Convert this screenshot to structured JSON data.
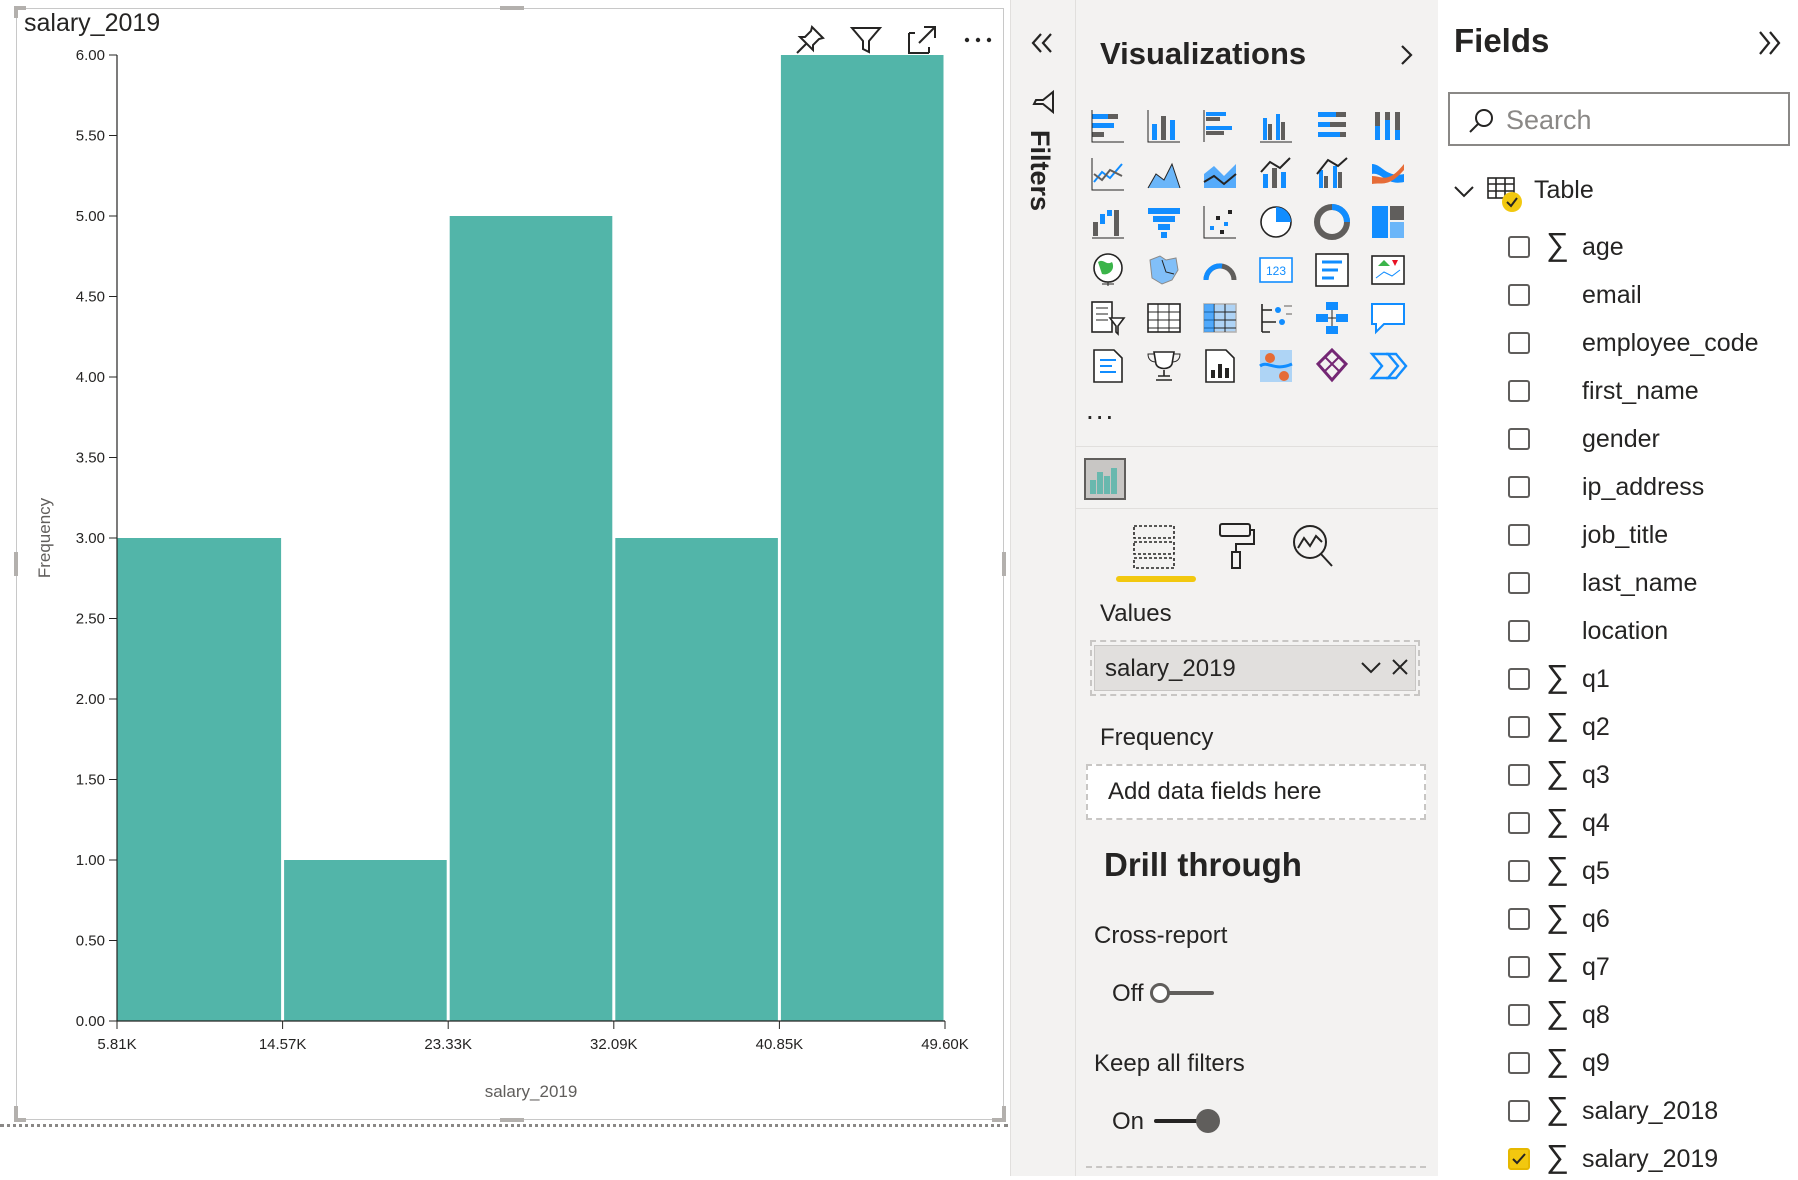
{
  "visual": {
    "title": "salary_2019",
    "header_icons": [
      "pin-icon",
      "filter-icon",
      "focus-mode-icon",
      "more-options-icon"
    ]
  },
  "chart_data": {
    "type": "bar",
    "title": "salary_2019",
    "xlabel": "salary_2019",
    "ylabel": "Frequency",
    "bin_edges": [
      "5.81K",
      "14.57K",
      "23.33K",
      "32.09K",
      "40.85K",
      "49.60K"
    ],
    "values": [
      3,
      1,
      5,
      3,
      6
    ],
    "yticks": [
      "0.00",
      "0.50",
      "1.00",
      "1.50",
      "2.00",
      "2.50",
      "3.00",
      "3.50",
      "4.00",
      "4.50",
      "5.00",
      "5.50",
      "6.00"
    ],
    "ylim": [
      0,
      6
    ],
    "bar_color": "#52b5a9",
    "grid": false
  },
  "filters": {
    "label": "Filters"
  },
  "visualizations": {
    "title": "Visualizations",
    "more_label": "...",
    "values_label": "Values",
    "values_field": "salary_2019",
    "frequency_label": "Frequency",
    "frequency_placeholder": "Add data fields here",
    "drill_through_title": "Drill through",
    "cross_report_label": "Cross-report",
    "cross_report_state": "Off",
    "keep_filters_label": "Keep all filters",
    "keep_filters_state": "On",
    "accent_color": "#f2c80f"
  },
  "fields": {
    "title": "Fields",
    "search_placeholder": "Search",
    "table_name": "Table",
    "items": [
      {
        "name": "age",
        "numeric": true,
        "checked": false
      },
      {
        "name": "email",
        "numeric": false,
        "checked": false
      },
      {
        "name": "employee_code",
        "numeric": false,
        "checked": false
      },
      {
        "name": "first_name",
        "numeric": false,
        "checked": false
      },
      {
        "name": "gender",
        "numeric": false,
        "checked": false
      },
      {
        "name": "ip_address",
        "numeric": false,
        "checked": false
      },
      {
        "name": "job_title",
        "numeric": false,
        "checked": false
      },
      {
        "name": "last_name",
        "numeric": false,
        "checked": false
      },
      {
        "name": "location",
        "numeric": false,
        "checked": false
      },
      {
        "name": "q1",
        "numeric": true,
        "checked": false
      },
      {
        "name": "q2",
        "numeric": true,
        "checked": false
      },
      {
        "name": "q3",
        "numeric": true,
        "checked": false
      },
      {
        "name": "q4",
        "numeric": true,
        "checked": false
      },
      {
        "name": "q5",
        "numeric": true,
        "checked": false
      },
      {
        "name": "q6",
        "numeric": true,
        "checked": false
      },
      {
        "name": "q7",
        "numeric": true,
        "checked": false
      },
      {
        "name": "q8",
        "numeric": true,
        "checked": false
      },
      {
        "name": "q9",
        "numeric": true,
        "checked": false
      },
      {
        "name": "salary_2018",
        "numeric": true,
        "checked": false
      },
      {
        "name": "salary_2019",
        "numeric": true,
        "checked": true
      }
    ]
  }
}
